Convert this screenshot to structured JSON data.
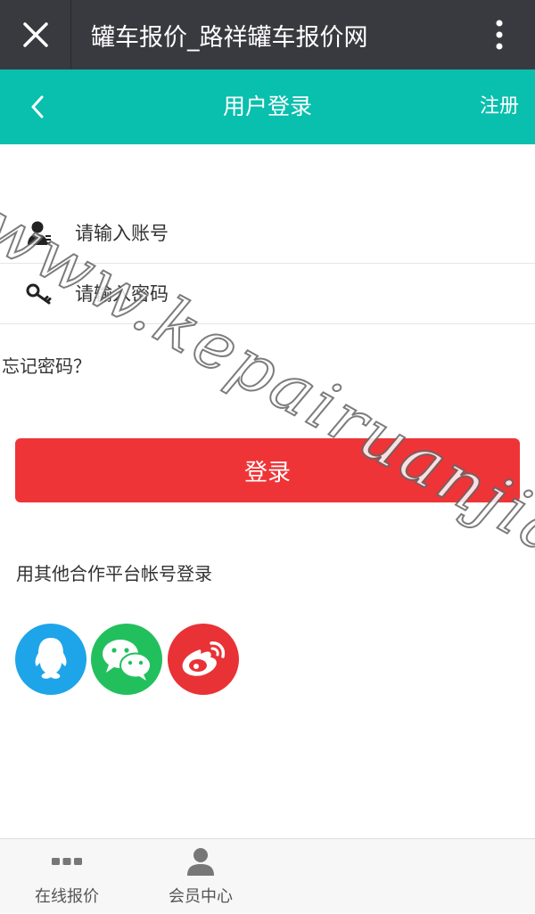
{
  "browser": {
    "title": "罐车报价_路祥罐车报价网",
    "close_icon": "close-icon",
    "more_icon": "more-vertical-icon"
  },
  "header": {
    "title": "用户登录",
    "register_label": "注册",
    "back_icon": "chevron-left-icon",
    "bg_color": "#09bfad"
  },
  "form": {
    "account": {
      "placeholder": "请输入账号",
      "value": "",
      "icon": "user-icon"
    },
    "password": {
      "placeholder": "请输入密码",
      "value": "",
      "icon": "key-icon"
    },
    "forgot_label": "忘记密码？",
    "login_label": "登录",
    "login_color": "#ef3437"
  },
  "social": {
    "title": "用其他合作平台帐号登录",
    "items": [
      {
        "name": "qq",
        "icon": "qq-icon",
        "color": "#1ea4e9"
      },
      {
        "name": "wechat",
        "icon": "wechat-icon",
        "color": "#22c05d"
      },
      {
        "name": "weibo",
        "icon": "weibo-icon",
        "color": "#e93236"
      }
    ]
  },
  "watermark": "www.kepairuanjian.com",
  "bottom_nav": {
    "items": [
      {
        "label": "在线报价",
        "icon": "dots-icon"
      },
      {
        "label": "会员中心",
        "icon": "user-icon"
      }
    ]
  }
}
